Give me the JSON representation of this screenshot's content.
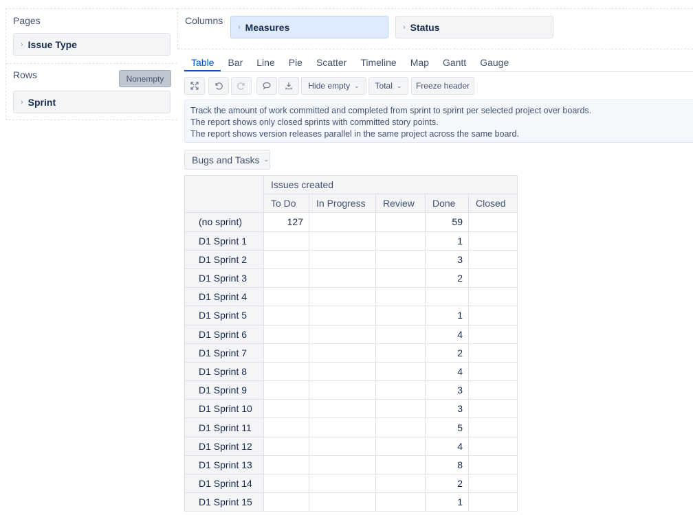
{
  "layout_panel": {
    "pages_title": "Pages",
    "pages_item": "Issue Type",
    "rows_title": "Rows",
    "nonempty_label": "Nonempty",
    "rows_item": "Sprint",
    "columns_title": "Columns",
    "columns_items": [
      "Measures",
      "Status"
    ]
  },
  "tabs": [
    "Table",
    "Bar",
    "Line",
    "Pie",
    "Scatter",
    "Timeline",
    "Map",
    "Gantt",
    "Gauge"
  ],
  "active_tab": "Table",
  "toolbar": {
    "hide_empty_label": "Hide empty",
    "total_label": "Total",
    "freeze_header_label": "Freeze header"
  },
  "description": [
    "Track the amount of work committed and completed from sprint to sprint per selected project over boards.",
    "The report shows only closed sprints with committed story points.",
    "The report shows version releases parallel in the same project across the same board."
  ],
  "page_filter": {
    "selected": "Bugs and Tasks"
  },
  "colors": {
    "accent": "#0052cc",
    "measures_bg": "#deebff",
    "nonempty_bg": "#c1c7d0"
  },
  "table": {
    "measure_header": "Issues created",
    "columns": [
      "To Do",
      "In Progress",
      "Review",
      "Done",
      "Closed"
    ],
    "rows": [
      {
        "label": "(no sprint)",
        "values": [
          "127",
          "",
          "",
          "59",
          ""
        ]
      },
      {
        "label": "D1 Sprint 1",
        "values": [
          "",
          "",
          "",
          "1",
          ""
        ]
      },
      {
        "label": "D1 Sprint 2",
        "values": [
          "",
          "",
          "",
          "3",
          ""
        ]
      },
      {
        "label": "D1 Sprint 3",
        "values": [
          "",
          "",
          "",
          "2",
          ""
        ]
      },
      {
        "label": "D1 Sprint 4",
        "values": [
          "",
          "",
          "",
          "",
          ""
        ]
      },
      {
        "label": "D1 Sprint 5",
        "values": [
          "",
          "",
          "",
          "1",
          ""
        ]
      },
      {
        "label": "D1 Sprint 6",
        "values": [
          "",
          "",
          "",
          "4",
          ""
        ]
      },
      {
        "label": "D1 Sprint 7",
        "values": [
          "",
          "",
          "",
          "2",
          ""
        ]
      },
      {
        "label": "D1 Sprint 8",
        "values": [
          "",
          "",
          "",
          "4",
          ""
        ]
      },
      {
        "label": "D1 Sprint 9",
        "values": [
          "",
          "",
          "",
          "3",
          ""
        ]
      },
      {
        "label": "D1 Sprint 10",
        "values": [
          "",
          "",
          "",
          "3",
          ""
        ]
      },
      {
        "label": "D1 Sprint 11",
        "values": [
          "",
          "",
          "",
          "5",
          ""
        ]
      },
      {
        "label": "D1 Sprint 12",
        "values": [
          "",
          "",
          "",
          "4",
          ""
        ]
      },
      {
        "label": "D1 Sprint 13",
        "values": [
          "",
          "",
          "",
          "8",
          ""
        ]
      },
      {
        "label": "D1 Sprint 14",
        "values": [
          "",
          "",
          "",
          "2",
          ""
        ]
      },
      {
        "label": "D1 Sprint 15",
        "values": [
          "",
          "",
          "",
          "1",
          ""
        ]
      }
    ]
  }
}
